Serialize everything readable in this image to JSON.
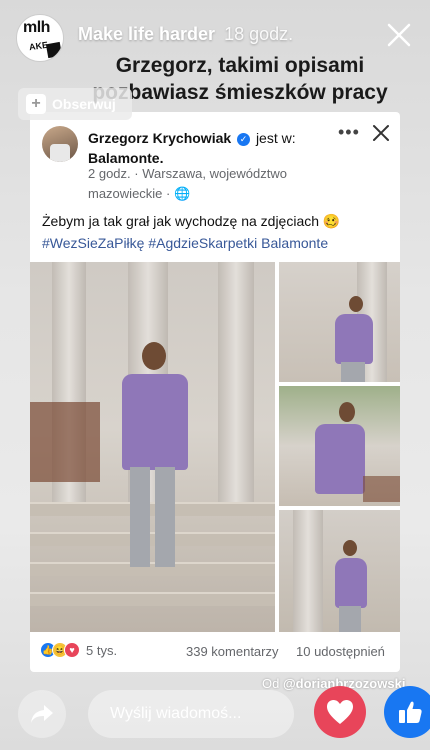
{
  "story": {
    "page_name": "Make life harder",
    "time_ago": "18 godz.",
    "headline": "Grzegorz, takimi opisami pozbawiasz śmieszków pracy",
    "follow_label": "Obserwuj",
    "logo_text_top": "mlh",
    "logo_text_mid": "AKE"
  },
  "post": {
    "author": "Grzegorz Krychowiak",
    "is_at": "jest w:",
    "place": "Balamonte.",
    "time": "2 godz.",
    "location": "Warszawa, województwo mazowieckie",
    "text": "Żebym ja tak grał jak wychodzę na zdjęciach 🥴",
    "hashtags": "#WezSieZaPiłkę #AgdzieSkarpetki Balamonte",
    "reactions_count": "5 tys.",
    "comments": "339 komentarzy",
    "shares": "10 udostępnień"
  },
  "credit": {
    "prefix": "Od",
    "handle": "@dorianbrzozowski"
  },
  "bottom": {
    "message_placeholder": "Wyślij wiadomoś..."
  },
  "colors": {
    "facebook_blue": "#1877f2",
    "heart_red": "#e8455a",
    "hashtag_blue": "#385898",
    "jacket_purple": "#8f77b8"
  }
}
